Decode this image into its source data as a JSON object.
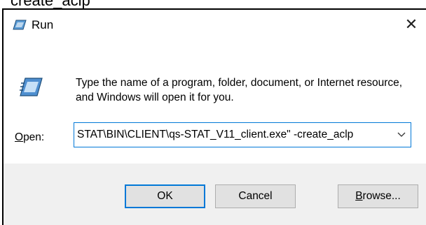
{
  "background_text": "create_aclp",
  "dialog": {
    "title": "Run",
    "title_icon": "run-icon",
    "close_glyph": "✕",
    "instructions": "Type the name of a program, folder, document, or Internet resource, and Windows will open it for you.",
    "open_label_accel": "O",
    "open_label_rest": "pen:",
    "open_value": "STAT\\BIN\\CLIENT\\qs-STAT_V11_client.exe\" -create_aclp",
    "buttons": {
      "ok": "OK",
      "cancel": "Cancel",
      "browse_accel": "B",
      "browse_rest": "rowse..."
    }
  },
  "colors": {
    "accent": "#0078d7",
    "footer_bg": "#f0f0f0",
    "button_bg": "#e1e1e1"
  }
}
